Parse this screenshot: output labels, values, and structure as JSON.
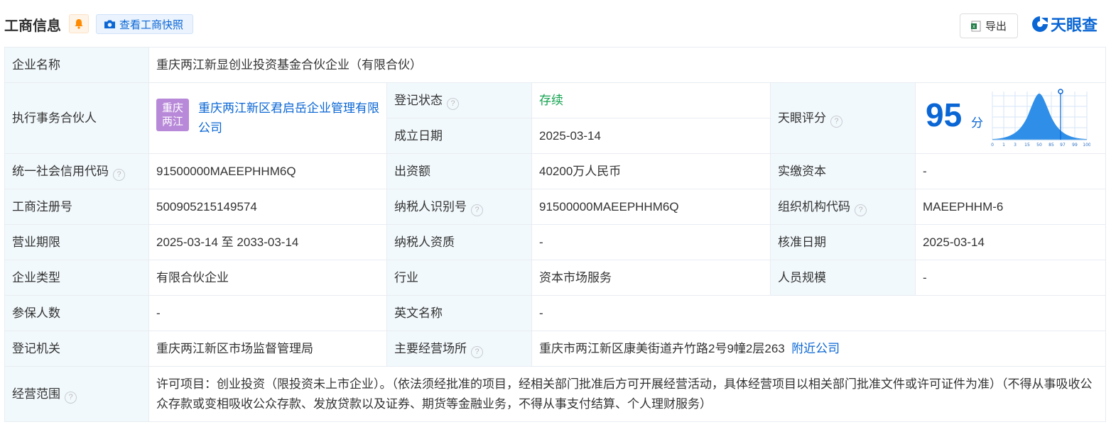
{
  "header": {
    "title": "工商信息",
    "snapshot_label": "查看工商快照",
    "export_label": "导出",
    "logo_text": "天眼查"
  },
  "info": {
    "company_name_label": "企业名称",
    "company_name": "重庆两江新显创业投资基金合伙企业（有限合伙）",
    "partner_label": "执行事务合伙人",
    "partner_badge": "重庆\n两江",
    "partner_name": "重庆两江新区君启岳企业管理有限公司",
    "reg_status_label": "登记状态",
    "reg_status": "存续",
    "established_label": "成立日期",
    "established": "2025-03-14",
    "score_label": "天眼评分",
    "score_value": "95",
    "score_unit": "分",
    "score_axis": [
      "0",
      "1",
      "3",
      "15",
      "50",
      "85",
      "97",
      "99",
      "100"
    ],
    "credit_code_label": "统一社会信用代码",
    "credit_code": "91500000MAEEPHHM6Q",
    "capital_label": "出资额",
    "capital": "40200万人民币",
    "paid_capital_label": "实缴资本",
    "paid_capital": "-",
    "reg_no_label": "工商注册号",
    "reg_no": "500905215149574",
    "taxpayer_id_label": "纳税人识别号",
    "taxpayer_id": "91500000MAEEPHHM6Q",
    "org_code_label": "组织机构代码",
    "org_code": "MAEEPHHM-6",
    "term_label": "营业期限",
    "term": "2025-03-14 至 2033-03-14",
    "taxpayer_qual_label": "纳税人资质",
    "taxpayer_qual": "-",
    "approval_date_label": "核准日期",
    "approval_date": "2025-03-14",
    "type_label": "企业类型",
    "type": "有限合伙企业",
    "industry_label": "行业",
    "industry": "资本市场服务",
    "staff_label": "人员规模",
    "staff": "-",
    "insured_label": "参保人数",
    "insured": "-",
    "english_name_label": "英文名称",
    "english_name": "-",
    "authority_label": "登记机关",
    "authority": "重庆两江新区市场监督管理局",
    "address_label": "主要经营场所",
    "address": "重庆市两江新区康美街道卉竹路2号9幢2层263",
    "nearby_label": "附近公司",
    "scope_label": "经营范围",
    "scope": "许可项目：创业投资（限投资未上市企业）。（依法须经批准的项目，经相关部门批准后方可开展经营活动，具体经营项目以相关部门批准文件或许可证件为准）（不得从事吸收公众存款或变相吸收公众存款、发放贷款以及证券、期货等金融业务，不得从事支付结算、个人理财服务）"
  },
  "colors": {
    "accent": "#0a66d4",
    "label_bg": "#f2f9fc",
    "status_green": "#14a350",
    "badge_purple": "#b889d8"
  }
}
